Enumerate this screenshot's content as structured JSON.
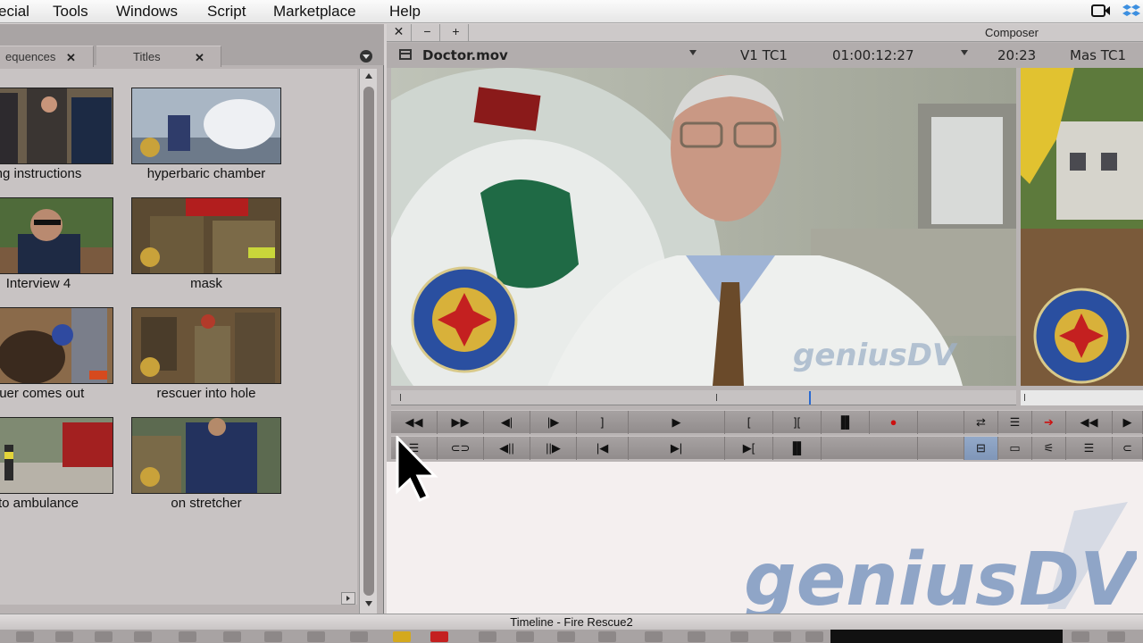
{
  "menubar": {
    "items": [
      "ecial",
      "Tools",
      "Windows",
      "Script",
      "Marketplace",
      "Help"
    ]
  },
  "bin": {
    "tabs": [
      {
        "label": "equences",
        "close": "✕"
      },
      {
        "label": "Titles",
        "close": "✕"
      }
    ],
    "clips": [
      {
        "label": "ng instructions"
      },
      {
        "label": "hyperbaric chamber"
      },
      {
        "label": "Interview 4"
      },
      {
        "label": "mask"
      },
      {
        "label": "cuer comes out"
      },
      {
        "label": "rescuer into hole"
      },
      {
        "label": "to ambulance"
      },
      {
        "label": "on stretcher"
      }
    ]
  },
  "composer": {
    "title": "Composer",
    "buttons": [
      "✕",
      "−",
      "+"
    ],
    "clip_name": "Doctor.mov",
    "track_label": "V1 TC1",
    "timecode": "01:00:12:27",
    "duration": "20:23",
    "record_label": "Mas TC1"
  },
  "timeline": {
    "title": "Timeline - Fire Rescue2"
  },
  "watermark": {
    "text": "geniusDV",
    "small_text": "geniusDV"
  },
  "logo": {
    "badge_text": "JACKSONVILLE FIRE AND RESCUE DEPARTMENT"
  },
  "colors": {
    "record_dot": "#cc1111",
    "accent_blue": "#2a6ad0",
    "watermark": "#8fa5c7"
  },
  "icons": [
    "rewind-icon",
    "fast-forward-icon",
    "step-back-icon",
    "step-forward-icon",
    "mark-out-icon",
    "play-icon",
    "mark-in-icon",
    "clear-marks-icon",
    "record-icon",
    "lift-icon",
    "extract-icon",
    "overwrite-icon",
    "splice-icon",
    "cursor-icon"
  ]
}
